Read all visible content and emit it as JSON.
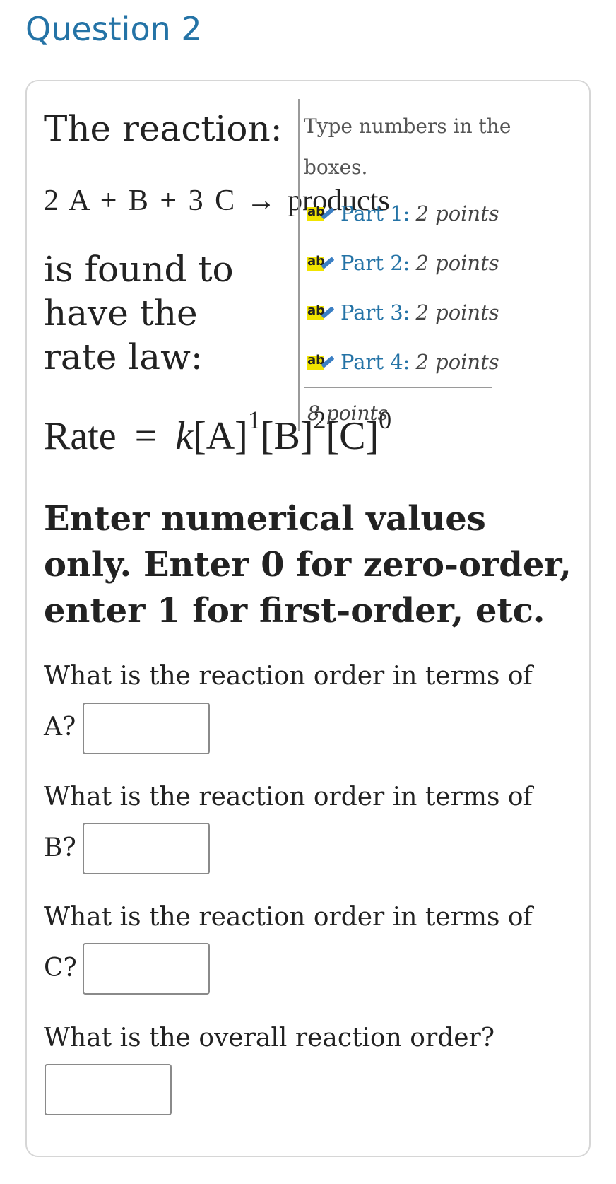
{
  "question_title": "Question 2",
  "intro": "The reaction:",
  "equation": "2 A + B + 3 C → products",
  "found_text": "is found to have the rate law:",
  "rate_law": {
    "label": "Rate",
    "equals": "=",
    "k": "k",
    "a": "[A]",
    "a_exp": "1",
    "b": "[B]",
    "b_exp": "2",
    "c": "[C]",
    "c_exp": "0"
  },
  "instruction": "Enter numerical values only. Enter 0 for zero-order, enter 1 for first-order, etc.",
  "questions": [
    {
      "text": "What is the reaction order in terms of",
      "label": "A?",
      "value": ""
    },
    {
      "text": "What is the reaction order in terms of",
      "label": "B?",
      "value": ""
    },
    {
      "text": "What is the reaction order in terms of",
      "label": "C?",
      "value": ""
    },
    {
      "text": "What is the overall reaction order?",
      "label": "",
      "value": ""
    }
  ],
  "panel": {
    "hint": "Type numbers in the boxes.",
    "parts": [
      {
        "label": "Part 1:",
        "points": "2 points",
        "icon": "ab-pencil-icon"
      },
      {
        "label": "Part 2:",
        "points": "2 points",
        "icon": "ab-pencil-icon"
      },
      {
        "label": "Part 3:",
        "points": "2 points",
        "icon": "ab-pencil-icon"
      },
      {
        "label": "Part 4:",
        "points": "2 points",
        "icon": "ab-pencil-icon"
      }
    ],
    "total": "8 points"
  },
  "colors": {
    "accent": "#2473a6",
    "icon_highlight": "#f1e400",
    "border": "#d6d6d6"
  }
}
